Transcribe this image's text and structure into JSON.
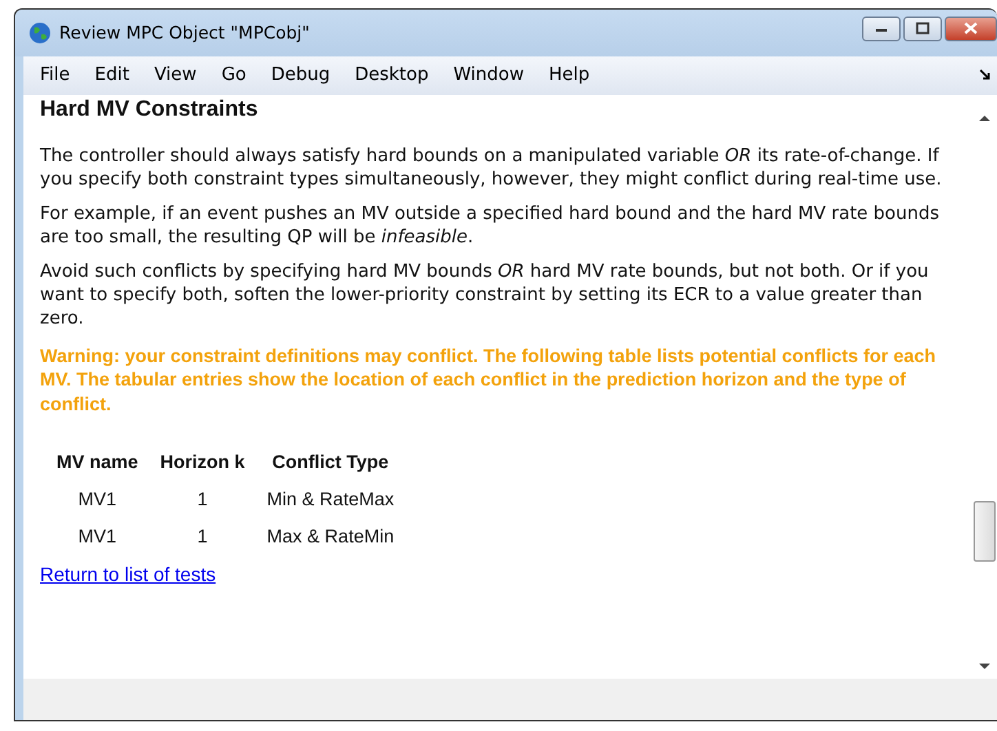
{
  "window": {
    "title": "Review MPC Object \"MPCobj\""
  },
  "menu": [
    "File",
    "Edit",
    "View",
    "Go",
    "Debug",
    "Desktop",
    "Window",
    "Help"
  ],
  "heading": "Hard MV Constraints",
  "paragraphs": [
    "The controller should always satisfy hard bounds on a manipulated variable *OR* its rate-of-change. If you specify both constraint types simultaneously, however, they might conflict during real-time use.",
    "For example, if an event pushes an MV outside a specified hard bound and the hard MV rate bounds are too small, the resulting QP will be *infeasible*.",
    "Avoid such conflicts by specifying hard MV bounds *OR* hard MV rate bounds, but not both. Or if you want to specify both, soften the lower-priority constraint by setting its ECR to a value greater than zero."
  ],
  "warning": "Warning: your constraint definitions may conflict. The following table lists potential conflicts for each MV. The tabular entries show the location of each conflict in the prediction horizon and the type of conflict.",
  "table": {
    "columns": [
      "MV name",
      "Horizon k",
      "Conflict Type"
    ],
    "rows": [
      [
        "MV1",
        "1",
        "Min & RateMax"
      ],
      [
        "MV1",
        "1",
        "Max & RateMin"
      ]
    ]
  },
  "link": "Return to list of tests "
}
